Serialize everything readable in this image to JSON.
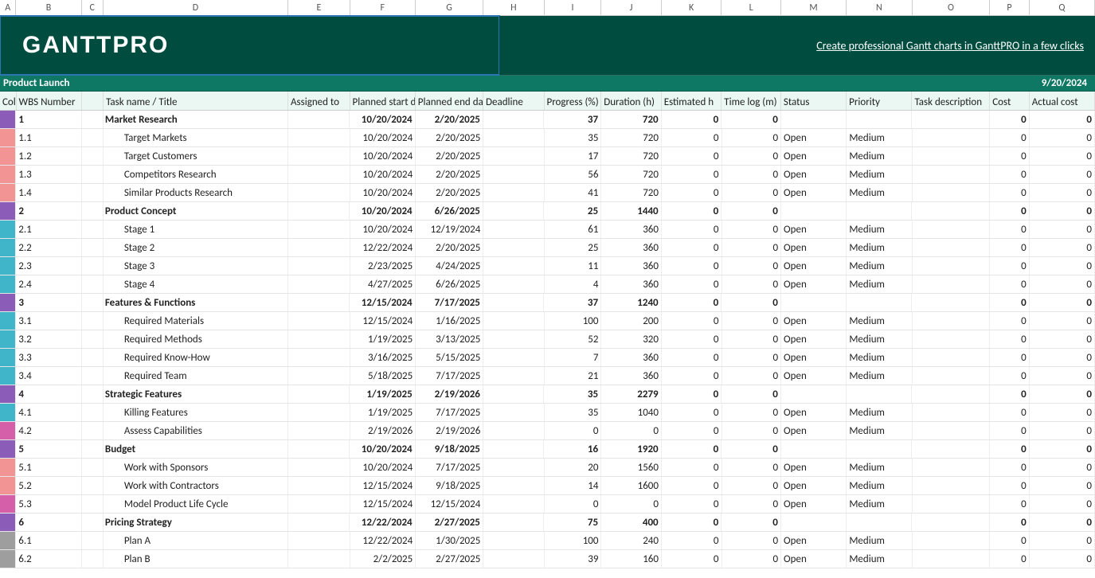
{
  "app_brand": "GANTTPRO",
  "header_link": "Create professional Gantt charts in GanttPRO in a few clicks",
  "project_title": "Product Launch",
  "project_date": "9/20/2024",
  "column_letters": [
    "A",
    "B",
    "C",
    "D",
    "E",
    "F",
    "G",
    "H",
    "I",
    "J",
    "K",
    "L",
    "M",
    "N",
    "O",
    "P",
    "Q"
  ],
  "columns": {
    "A": "Color",
    "B": "WBS Number",
    "C": "",
    "D": "Task name / Title",
    "E": "Assigned to",
    "F": "Planned start date",
    "G": "Planned end date",
    "H": "Deadline",
    "I": "Progress (%)",
    "J": "Duration (h)",
    "K": "Estimated h",
    "L": "Time log (m)",
    "M": "Status",
    "N": "Priority",
    "O": "Task description",
    "P": "Cost",
    "Q": "Actual cost"
  },
  "rows": [
    {
      "color": "#8b5cb8",
      "wbs": "1",
      "name": "Market Research",
      "start": "10/20/2024",
      "end": "2/20/2025",
      "progress": "37",
      "duration": "720",
      "est": "0",
      "log": "0",
      "status": "",
      "priority": "",
      "cost": "0",
      "actual": "0",
      "bold": true
    },
    {
      "color": "#f29394",
      "wbs": "1.1",
      "name": "Target Markets",
      "start": "10/20/2024",
      "end": "2/20/2025",
      "progress": "35",
      "duration": "720",
      "est": "0",
      "log": "0",
      "status": "Open",
      "priority": "Medium",
      "cost": "0",
      "actual": "0",
      "bold": false,
      "indent": true
    },
    {
      "color": "#f29394",
      "wbs": "1.2",
      "name": "Target Customers",
      "start": "10/20/2024",
      "end": "2/20/2025",
      "progress": "17",
      "duration": "720",
      "est": "0",
      "log": "0",
      "status": "Open",
      "priority": "Medium",
      "cost": "0",
      "actual": "0",
      "bold": false,
      "indent": true
    },
    {
      "color": "#f29394",
      "wbs": "1.3",
      "name": "Competitors Research",
      "start": "10/20/2024",
      "end": "2/20/2025",
      "progress": "56",
      "duration": "720",
      "est": "0",
      "log": "0",
      "status": "Open",
      "priority": "Medium",
      "cost": "0",
      "actual": "0",
      "bold": false,
      "indent": true
    },
    {
      "color": "#f29394",
      "wbs": "1.4",
      "name": "Similar Products Research",
      "start": "10/20/2024",
      "end": "2/20/2025",
      "progress": "41",
      "duration": "720",
      "est": "0",
      "log": "0",
      "status": "Open",
      "priority": "Medium",
      "cost": "0",
      "actual": "0",
      "bold": false,
      "indent": true
    },
    {
      "color": "#8b5cb8",
      "wbs": "2",
      "name": "Product Concept",
      "start": "10/20/2024",
      "end": "6/26/2025",
      "progress": "25",
      "duration": "1440",
      "est": "0",
      "log": "0",
      "status": "",
      "priority": "",
      "cost": "0",
      "actual": "0",
      "bold": true
    },
    {
      "color": "#40b5c9",
      "wbs": "2.1",
      "name": "Stage 1",
      "start": "10/20/2024",
      "end": "12/19/2024",
      "progress": "61",
      "duration": "360",
      "est": "0",
      "log": "0",
      "status": "Open",
      "priority": "Medium",
      "cost": "0",
      "actual": "0",
      "bold": false,
      "indent": true
    },
    {
      "color": "#40b5c9",
      "wbs": "2.2",
      "name": "Stage 2",
      "start": "12/22/2024",
      "end": "2/20/2025",
      "progress": "25",
      "duration": "360",
      "est": "0",
      "log": "0",
      "status": "Open",
      "priority": "Medium",
      "cost": "0",
      "actual": "0",
      "bold": false,
      "indent": true
    },
    {
      "color": "#40b5c9",
      "wbs": "2.3",
      "name": "Stage 3",
      "start": "2/23/2025",
      "end": "4/24/2025",
      "progress": "11",
      "duration": "360",
      "est": "0",
      "log": "0",
      "status": "Open",
      "priority": "Medium",
      "cost": "0",
      "actual": "0",
      "bold": false,
      "indent": true
    },
    {
      "color": "#40b5c9",
      "wbs": "2.4",
      "name": "Stage 4",
      "start": "4/27/2025",
      "end": "6/26/2025",
      "progress": "4",
      "duration": "360",
      "est": "0",
      "log": "0",
      "status": "Open",
      "priority": "Medium",
      "cost": "0",
      "actual": "0",
      "bold": false,
      "indent": true
    },
    {
      "color": "#8b5cb8",
      "wbs": "3",
      "name": "Features & Functions",
      "start": "12/15/2024",
      "end": "7/17/2025",
      "progress": "37",
      "duration": "1240",
      "est": "0",
      "log": "0",
      "status": "",
      "priority": "",
      "cost": "0",
      "actual": "0",
      "bold": true
    },
    {
      "color": "#40b5c9",
      "wbs": "3.1",
      "name": "Required Materials",
      "start": "12/15/2024",
      "end": "1/16/2025",
      "progress": "100",
      "duration": "200",
      "est": "0",
      "log": "0",
      "status": "Open",
      "priority": "Medium",
      "cost": "0",
      "actual": "0",
      "bold": false,
      "indent": true
    },
    {
      "color": "#40b5c9",
      "wbs": "3.2",
      "name": "Required Methods",
      "start": "1/19/2025",
      "end": "3/13/2025",
      "progress": "52",
      "duration": "320",
      "est": "0",
      "log": "0",
      "status": "Open",
      "priority": "Medium",
      "cost": "0",
      "actual": "0",
      "bold": false,
      "indent": true
    },
    {
      "color": "#40b5c9",
      "wbs": "3.3",
      "name": "Required Know-How",
      "start": "3/16/2025",
      "end": "5/15/2025",
      "progress": "7",
      "duration": "360",
      "est": "0",
      "log": "0",
      "status": "Open",
      "priority": "Medium",
      "cost": "0",
      "actual": "0",
      "bold": false,
      "indent": true
    },
    {
      "color": "#40b5c9",
      "wbs": "3.4",
      "name": "Required Team",
      "start": "5/18/2025",
      "end": "7/17/2025",
      "progress": "21",
      "duration": "360",
      "est": "0",
      "log": "0",
      "status": "Open",
      "priority": "Medium",
      "cost": "0",
      "actual": "0",
      "bold": false,
      "indent": true
    },
    {
      "color": "#8b5cb8",
      "wbs": "4",
      "name": "Strategic Features",
      "start": "1/19/2025",
      "end": "2/19/2026",
      "progress": "35",
      "duration": "2279",
      "est": "0",
      "log": "0",
      "status": "",
      "priority": "",
      "cost": "0",
      "actual": "0",
      "bold": true
    },
    {
      "color": "#40b5c9",
      "wbs": "4.1",
      "name": "Killing Features",
      "start": "1/19/2025",
      "end": "7/17/2025",
      "progress": "35",
      "duration": "1040",
      "est": "0",
      "log": "0",
      "status": "Open",
      "priority": "Medium",
      "cost": "0",
      "actual": "0",
      "bold": false,
      "indent": true
    },
    {
      "color": "#d65fa9",
      "wbs": "4.2",
      "name": "Assess Capabilities",
      "start": "2/19/2026",
      "end": "2/19/2026",
      "progress": "0",
      "duration": "0",
      "est": "0",
      "log": "0",
      "status": "Open",
      "priority": "Medium",
      "cost": "0",
      "actual": "0",
      "bold": false,
      "indent": true
    },
    {
      "color": "#8b5cb8",
      "wbs": "5",
      "name": "Budget",
      "start": "10/20/2024",
      "end": "9/18/2025",
      "progress": "16",
      "duration": "1920",
      "est": "0",
      "log": "0",
      "status": "",
      "priority": "",
      "cost": "0",
      "actual": "0",
      "bold": true
    },
    {
      "color": "#f29394",
      "wbs": "5.1",
      "name": "Work with Sponsors",
      "start": "10/20/2024",
      "end": "7/17/2025",
      "progress": "20",
      "duration": "1560",
      "est": "0",
      "log": "0",
      "status": "Open",
      "priority": "Medium",
      "cost": "0",
      "actual": "0",
      "bold": false,
      "indent": true
    },
    {
      "color": "#f29394",
      "wbs": "5.2",
      "name": "Work with Contractors",
      "start": "12/15/2024",
      "end": "9/18/2025",
      "progress": "14",
      "duration": "1600",
      "est": "0",
      "log": "0",
      "status": "Open",
      "priority": "Medium",
      "cost": "0",
      "actual": "0",
      "bold": false,
      "indent": true
    },
    {
      "color": "#d65fa9",
      "wbs": "5.3",
      "name": "Model Product Life Cycle",
      "start": "12/15/2024",
      "end": "12/15/2024",
      "progress": "0",
      "duration": "0",
      "est": "0",
      "log": "0",
      "status": "Open",
      "priority": "Medium",
      "cost": "0",
      "actual": "0",
      "bold": false,
      "indent": true
    },
    {
      "color": "#8b5cb8",
      "wbs": "6",
      "name": "Pricing Strategy",
      "start": "12/22/2024",
      "end": "2/27/2025",
      "progress": "75",
      "duration": "400",
      "est": "0",
      "log": "0",
      "status": "",
      "priority": "",
      "cost": "0",
      "actual": "0",
      "bold": true
    },
    {
      "color": "#9e9e9e",
      "wbs": "6.1",
      "name": "Plan A",
      "start": "12/22/2024",
      "end": "1/30/2025",
      "progress": "100",
      "duration": "240",
      "est": "0",
      "log": "0",
      "status": "Open",
      "priority": "Medium",
      "cost": "0",
      "actual": "0",
      "bold": false,
      "indent": true
    },
    {
      "color": "#9e9e9e",
      "wbs": "6.2",
      "name": "Plan B",
      "start": "2/2/2025",
      "end": "2/27/2025",
      "progress": "39",
      "duration": "160",
      "est": "0",
      "log": "0",
      "status": "Open",
      "priority": "Medium",
      "cost": "0",
      "actual": "0",
      "bold": false,
      "indent": true
    }
  ]
}
